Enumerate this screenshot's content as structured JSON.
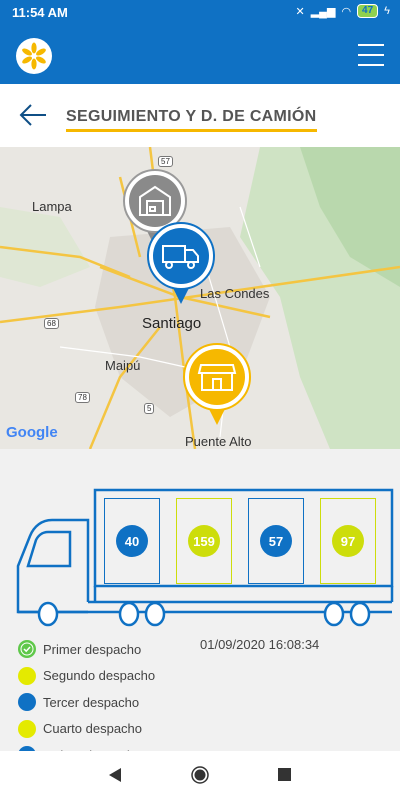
{
  "status_bar": {
    "time": "11:54 AM",
    "battery": "47"
  },
  "header": {
    "title": "SEGUIMIENTO Y D. DE CAMIÓN"
  },
  "map": {
    "labels": [
      "Lampa",
      "Las Condes",
      "Santiago",
      "Maipú",
      "Puente Alto"
    ],
    "road_shields": [
      "57",
      "68",
      "78",
      "5"
    ],
    "attribution": "Google"
  },
  "compartments": [
    {
      "value": "40",
      "color": "#0f71c4"
    },
    {
      "value": "159",
      "color": "#cddd0b"
    },
    {
      "value": "57",
      "color": "#0f71c4"
    },
    {
      "value": "97",
      "color": "#cddd0b"
    }
  ],
  "legend": [
    {
      "label": "Primer despacho",
      "color": "#5fc84a",
      "icon": "check-icon"
    },
    {
      "label": "Segundo despacho",
      "color": "#e4ea00"
    },
    {
      "label": "Tercer despacho",
      "color": "#0f71c4"
    },
    {
      "label": "Cuarto despacho",
      "color": "#e4ea00"
    },
    {
      "label": "Quinto despacho",
      "color": "#0f71c4"
    }
  ],
  "dispatch_time": "01/09/2020 16:08:34"
}
